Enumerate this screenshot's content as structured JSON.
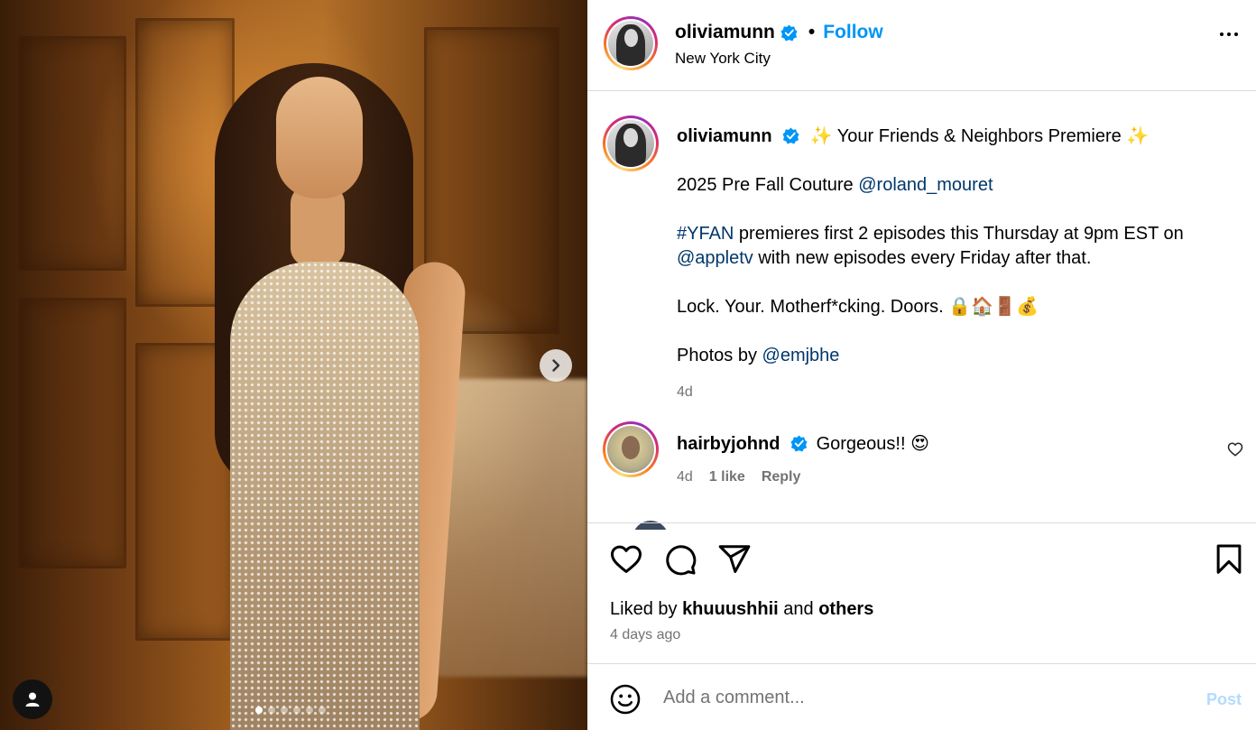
{
  "post": {
    "author": "oliviamunn",
    "follow_label": "Follow",
    "separator": "•",
    "location": "New York City",
    "media": {
      "slide_count": 6,
      "active_slide": 1
    }
  },
  "caption": {
    "author": "oliviamunn",
    "line1": "✨ Your Friends & Neighbors Premiere ✨",
    "line2_text": "2025 Pre Fall Couture ",
    "line2_mention": "@roland_mouret",
    "line3_hashtag": "#YFAN",
    "line3_text": " premieres first 2 episodes this Thursday at 9pm EST on ",
    "line3_mention": "@appletv",
    "line3_tail": " with new episodes every Friday after that.",
    "line4": "Lock. Your. Motherf*cking. Doors. 🔒🏠🚪💰",
    "line5_text": "Photos by ",
    "line5_mention": "@emjbhe",
    "time": "4d"
  },
  "comments": [
    {
      "author": "hairbyjohnd",
      "text": "Gorgeous!! 😍",
      "time": "4d",
      "likes": "1 like",
      "reply": "Reply"
    }
  ],
  "engagement": {
    "liked_prefix": "Liked by ",
    "liked_user": "khuuushhii",
    "liked_mid": " and ",
    "liked_others": "others",
    "date": "4 days ago"
  },
  "composer": {
    "placeholder": "Add a comment...",
    "post_label": "Post"
  },
  "colors": {
    "link": "#0095f6",
    "mention": "#00376b",
    "muted": "#737373",
    "verified": "#0095f6",
    "post_disabled": "#b3dbff"
  }
}
